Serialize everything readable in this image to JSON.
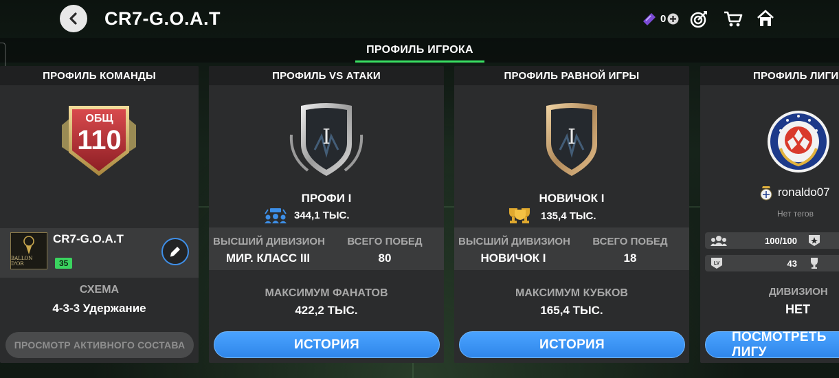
{
  "header": {
    "title": "CR7-G.O.A.T",
    "currency_count": "0"
  },
  "tabs": [
    {
      "label": "ПРОФИЛЬ ИГРОКА",
      "active": true
    }
  ],
  "team_card": {
    "title": "ПРОФИЛЬ КОМАНДЫ",
    "ovr_label": "ОБЩ",
    "ovr_value": "110",
    "badge_text": "BALLON D'OR",
    "player_name": "CR7-G.O.A.T",
    "level": "35",
    "formation_label": "СХЕМА",
    "formation_value": "4-3-3 Удержание",
    "button": "ПРОСМОТР АКТИВНОГО СОСТАВА"
  },
  "attack_card": {
    "title": "ПРОФИЛЬ VS АТАКИ",
    "shield_numeral": "I",
    "rank_name": "ПРОФИ I",
    "points": "344,1 ТЫС.",
    "highest_div_label": "ВЫСШИЙ ДИВИЗИОН",
    "highest_div_value": "МИР. КЛАСС III",
    "total_wins_label": "ВСЕГО ПОБЕД",
    "total_wins_value": "80",
    "max_label": "МАКСИМУМ ФАНАТОВ",
    "max_value": "422,2 ТЫС.",
    "button": "ИСТОРИЯ"
  },
  "rivals_card": {
    "title": "ПРОФИЛЬ РАВНОЙ ИГРЫ",
    "shield_numeral": "I",
    "rank_name": "НОВИЧОК I",
    "points": "135,4 ТЫС.",
    "highest_div_label": "ВЫСШИЙ ДИВИЗИОН",
    "highest_div_value": "НОВИЧОК I",
    "total_wins_label": "ВСЕГО ПОБЕД",
    "total_wins_value": "18",
    "max_label": "МАКСИМУМ КУБКОВ",
    "max_value": "165,4 ТЫС.",
    "button": "ИСТОРИЯ"
  },
  "league_card": {
    "title": "ПРОФИЛЬ ЛИГИ",
    "username": "ronaldo07",
    "tags": "Нет тегов",
    "members": "100/100",
    "level": "43",
    "division_label": "ДИВИЗИОН",
    "division_value": "НЕТ",
    "button": "ПОСМОТРЕТЬ ЛИГУ"
  },
  "colors": {
    "accent_green": "#39e063",
    "button_blue": "#3a93f2",
    "ovr_red": "#c0393b",
    "gold": "#d8b66a"
  }
}
